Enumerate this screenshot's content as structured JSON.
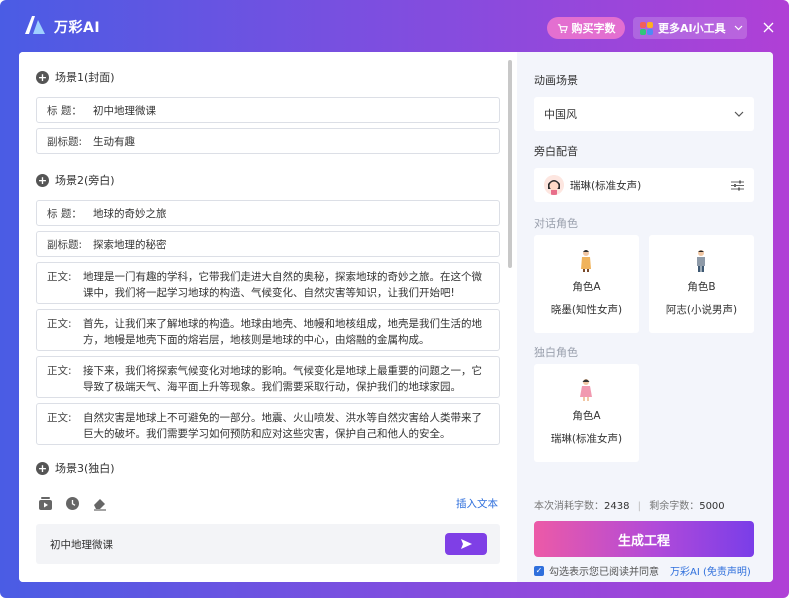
{
  "app": {
    "title": "万彩AI"
  },
  "header": {
    "buy_label": "购买字数",
    "tools_label": "更多AI小工具",
    "colors": {
      "tile1": "#f25f5c",
      "tile2": "#ffb020",
      "tile3": "#2fc67a",
      "tile4": "#4d8bf5"
    }
  },
  "scenes": {
    "s1": {
      "title": "场景1(封面)",
      "fields": [
        {
          "label": "标  题：",
          "value": "初中地理微课"
        },
        {
          "label": "副标题:",
          "value": "生动有趣"
        }
      ]
    },
    "s2": {
      "title": "场景2(旁白)",
      "fields": [
        {
          "label": "标  题：",
          "value": "地球的奇妙之旅"
        },
        {
          "label": "副标题:",
          "value": "探索地理的秘密"
        }
      ],
      "paragraphs": [
        {
          "label": "正文:",
          "text": "地理是一门有趣的学科，它带我们走进大自然的奥秘，探索地球的奇妙之旅。在这个微课中，我们将一起学习地球的构造、气候变化、自然灾害等知识，让我们开始吧!"
        },
        {
          "label": "正文:",
          "text": "首先，让我们来了解地球的构造。地球由地壳、地幔和地核组成，地壳是我们生活的地方，地幔是地壳下面的熔岩层，地核则是地球的中心，由熔融的金属构成。"
        },
        {
          "label": "正文:",
          "text": "接下来，我们将探索气候变化对地球的影响。气候变化是地球上最重要的问题之一，它导致了极端天气、海平面上升等现象。我们需要采取行动，保护我们的地球家园。"
        },
        {
          "label": "正文:",
          "text": "自然灾害是地球上不可避免的一部分。地震、火山喷发、洪水等自然灾害给人类带来了巨大的破坏。我们需要学习如何预防和应对这些灾害，保护自己和他人的安全。"
        }
      ]
    },
    "s3": {
      "title": "场景3(独白)"
    }
  },
  "editor": {
    "insert_text": "插入文本",
    "input_value": "初中地理微课"
  },
  "right": {
    "scene_label": "动画场景",
    "scene_value": "中国风",
    "narration_label": "旁白配音",
    "narration_voice": "瑞琳(标准女声)",
    "dialogue_label": "对话角色",
    "dialogue_roles": [
      {
        "name": "角色A",
        "voice": "晓墨(知性女声)"
      },
      {
        "name": "角色B",
        "voice": "阿志(小说男声)"
      }
    ],
    "monologue_label": "独白角色",
    "monologue_role": {
      "name": "角色A",
      "voice": "瑞琳(标准女声)"
    },
    "stats": {
      "used_label": "本次消耗字数：",
      "used_value": "2438",
      "sep": "|",
      "remain_label": "剩余字数：",
      "remain_value": "5000"
    },
    "generate_label": "生成工程",
    "agree_text": "勾选表示您已阅读并同意",
    "agree_link": "万彩AI (免责声明)"
  }
}
